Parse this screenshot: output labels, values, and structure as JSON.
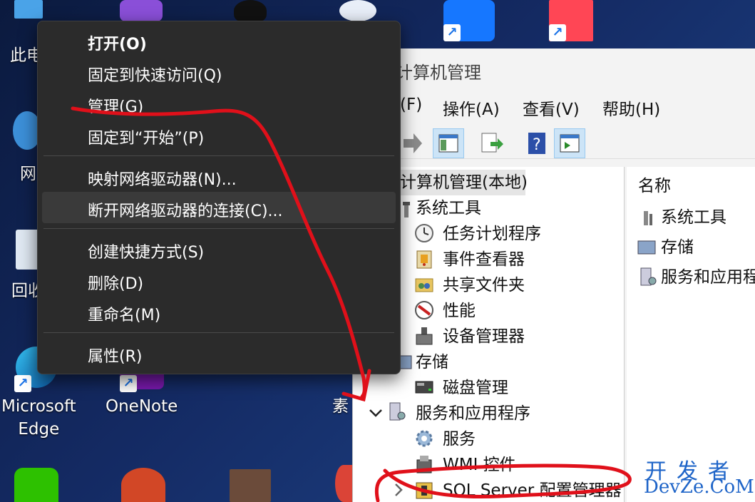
{
  "desktop": {
    "icons": [
      {
        "label": "此电",
        "shortcut": false
      },
      {
        "label": "网",
        "shortcut": false
      },
      {
        "label": "回收",
        "shortcut": false
      },
      {
        "label": "Microsoft\nEdge",
        "shortcut": true
      },
      {
        "label": "OneNote",
        "shortcut": true
      },
      {
        "label": "素",
        "shortcut": false
      }
    ],
    "shortcut_glyph": "↗"
  },
  "context_menu": {
    "items": [
      {
        "label": "打开(O)",
        "bold": true
      },
      {
        "label": "固定到快速访问(Q)"
      },
      {
        "label": "管理(G)"
      },
      {
        "label": "固定到“开始”(P)"
      },
      {
        "label": "映射网络驱动器(N)..."
      },
      {
        "label": "断开网络驱动器的连接(C)..."
      },
      {
        "label": "创建快捷方式(S)"
      },
      {
        "label": "删除(D)"
      },
      {
        "label": "重命名(M)"
      },
      {
        "label": "属性(R)"
      }
    ]
  },
  "mmc": {
    "title": "计算机管理",
    "menu": [
      "(F)",
      "操作(A)",
      "查看(V)",
      "帮助(H)"
    ],
    "tree": {
      "root": "计算机管理(本地)",
      "system_tools": "系统工具",
      "task_scheduler": "任务计划程序",
      "event_viewer": "事件查看器",
      "shared_folders": "共享文件夹",
      "performance": "性能",
      "device_manager": "设备管理器",
      "storage": "存储",
      "disk_management": "磁盘管理",
      "services_apps": "服务和应用程序",
      "services": "服务",
      "wmi": "WMI 控件",
      "sql": "SQL Server 配置管理器"
    },
    "list": {
      "header": "名称",
      "items": [
        "系统工具",
        "存储",
        "服务和应用程"
      ]
    }
  },
  "watermark": {
    "line1": "开发者",
    "line2": "DevZe.CoM"
  },
  "colors": {
    "annotation": "#e0101a",
    "menu_bg": "#2b2b2b",
    "accent": "#1e64c8"
  }
}
